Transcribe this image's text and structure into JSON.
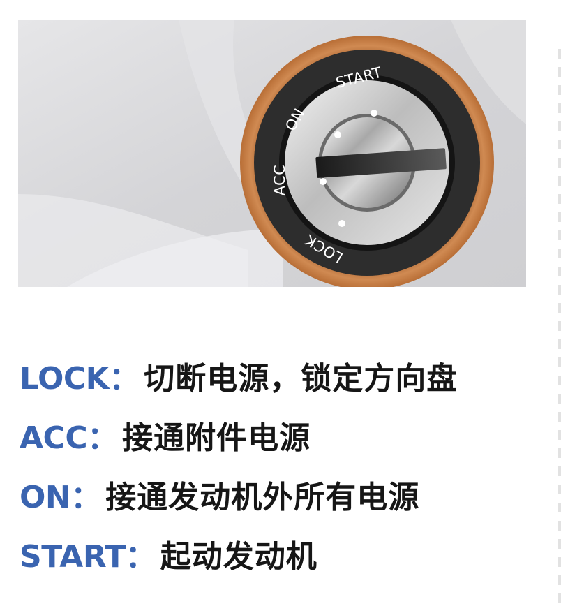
{
  "switch": {
    "positions": [
      "START",
      "ON",
      "ACC",
      "LOCK"
    ]
  },
  "descriptions": [
    {
      "key": "LOCK",
      "colon": "：",
      "text": "切断电源，锁定方向盘"
    },
    {
      "key": "ACC",
      "colon": "：",
      "text": "接通附件电源"
    },
    {
      "key": "ON",
      "colon": "：",
      "text": "接通发动机外所有电源"
    },
    {
      "key": "START",
      "colon": "：",
      "text": "起动发动机"
    }
  ],
  "colors": {
    "accent": "#3a64b0",
    "bezel": "#c8804a",
    "ring": "#2b2b2b",
    "background": "#dcdcde"
  },
  "icons": [
    "ignition-switch-icon",
    "key-slot-icon"
  ]
}
